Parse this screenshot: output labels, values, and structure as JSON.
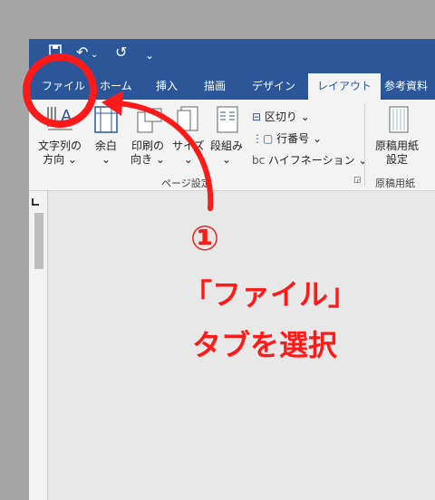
{
  "tabs": [
    "ファイル",
    "ホーム",
    "挿入",
    "描画",
    "デザイン",
    "レイアウト",
    "参考資料"
  ],
  "ribbon": {
    "text_dir": [
      "文字列の",
      "方向"
    ],
    "margins": "余白",
    "orientation": [
      "印刷の",
      "向き"
    ],
    "size": "サイズ",
    "columns": "段組み",
    "breaks": "区切り",
    "line_numbers": "行番号",
    "hyphenation": "ハイフネーション",
    "genko": [
      "原稿用紙",
      "設定"
    ],
    "page_setup_group": "ページ設定",
    "genko_group": "原稿用紙"
  },
  "annotation": {
    "step": "①",
    "line1": "「ファイル」",
    "line2": "タブを選択"
  },
  "colors": {
    "title_bar": "#2b579a",
    "annotation": "#ff1a1a"
  }
}
